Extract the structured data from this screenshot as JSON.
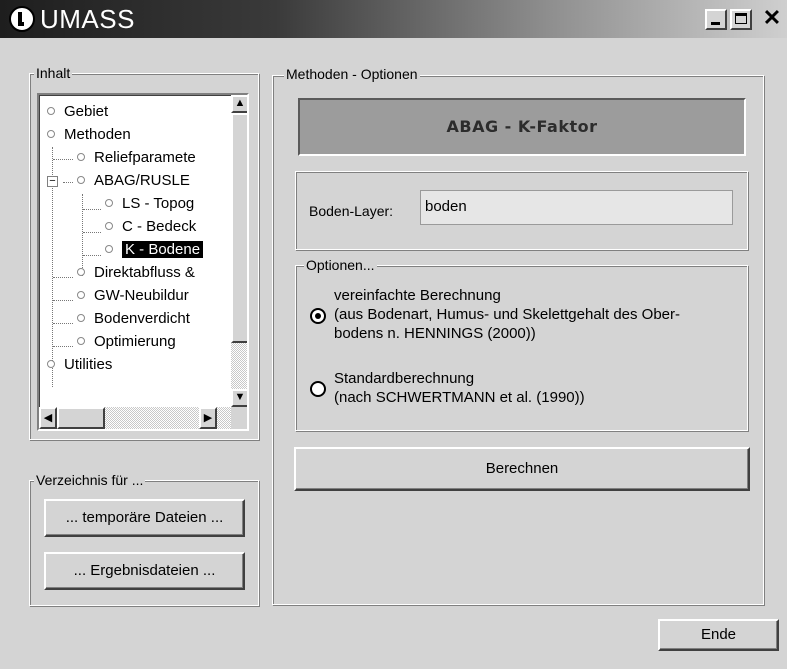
{
  "window": {
    "title": "UMASS"
  },
  "inhalt": {
    "label": "Inhalt",
    "tree": [
      {
        "label": "Gebiet"
      },
      {
        "label": "Methoden"
      },
      {
        "label": "Reliefparamete"
      },
      {
        "label": "ABAG/RUSLE"
      },
      {
        "label": "LS - Topog"
      },
      {
        "label": "C - Bedeck"
      },
      {
        "label": "K - Bodene",
        "selected": true
      },
      {
        "label": "Direktabfluss &"
      },
      {
        "label": "GW-Neubildur"
      },
      {
        "label": "Bodenverdicht"
      },
      {
        "label": "Optimierung"
      },
      {
        "label": "Utilities"
      }
    ],
    "expander": "−"
  },
  "verzeichnis": {
    "label": "Verzeichnis für ...",
    "temp_button": "... temporäre Dateien ...",
    "result_button": "... Ergebnisdateien ..."
  },
  "methoden": {
    "label": "Methoden - Optionen",
    "header": "ABAG - K-Faktor",
    "boden_layer_label": "Boden-Layer:",
    "boden_layer_value": "boden",
    "optionen_label": "Optionen...",
    "option1": {
      "line1": "vereinfachte Berechnung",
      "line2": "(aus Bodenart, Humus- und Skelettgehalt des Ober-",
      "line3": "bodens n. HENNINGS (2000))",
      "checked": true
    },
    "option2": {
      "line1": "Standardberechnung",
      "line2": "(nach SCHWERTMANN et al. (1990))",
      "checked": false
    },
    "berechnen_button": "Berechnen"
  },
  "footer": {
    "ende_button": "Ende"
  }
}
